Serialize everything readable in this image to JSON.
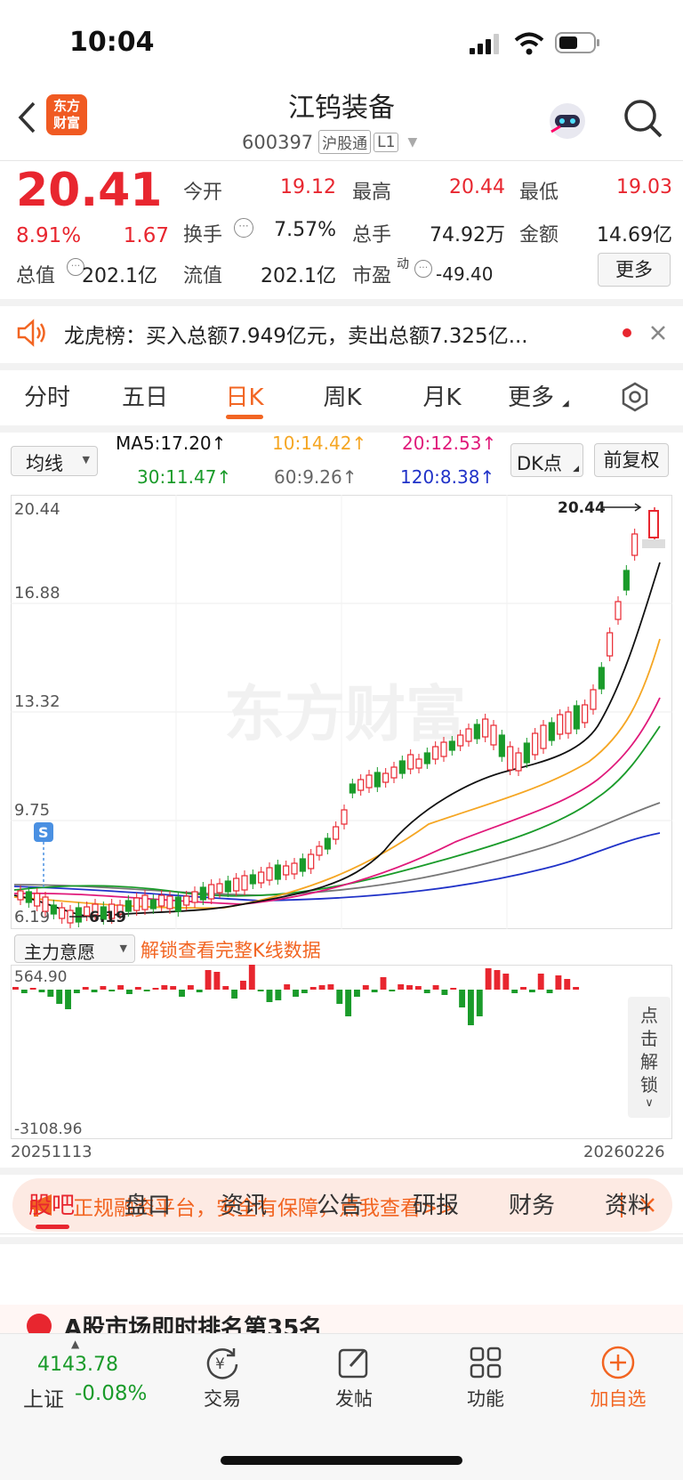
{
  "status": {
    "time": "10:04"
  },
  "header": {
    "logo_line1": "东方",
    "logo_line2": "财富",
    "name": "江钨装备",
    "code": "600397",
    "tag": "沪股通",
    "level": "L1"
  },
  "quote": {
    "price": "20.41",
    "pct": "8.91%",
    "chg": "1.67",
    "open_label": "今开",
    "open": "19.12",
    "high_label": "最高",
    "high": "20.44",
    "low_label": "最低",
    "low": "19.03",
    "turnover_label": "换手",
    "turnover": "7.57%",
    "volume_label": "总手",
    "volume": "74.92万",
    "amount_label": "金额",
    "amount": "14.69亿",
    "mcap_label": "总值",
    "mcap": "202.1亿",
    "float_label": "流值",
    "float": "202.1亿",
    "pe_label": "市盈",
    "pe_sup": "动",
    "pe": "-49.40",
    "more": "更多"
  },
  "notice": {
    "text": "龙虎榜：买入总额7.949亿元，卖出总额7.325亿..."
  },
  "tabs": [
    "分时",
    "五日",
    "日K",
    "周K",
    "月K",
    "更多"
  ],
  "ma": {
    "select": "均线",
    "ma5": "MA5:17.20",
    "ma10": "10:14.42",
    "ma20": "20:12.53",
    "ma30": "30:11.47",
    "ma60": "60:9.26",
    "ma120": "120:8.38",
    "dk": "DK点",
    "fq": "前复权",
    "arrow": "↑"
  },
  "kchart": {
    "y_labels": [
      "20.44",
      "16.88",
      "13.32",
      "9.75",
      "6.19"
    ],
    "max_label": "20.44",
    "min_label": "6.19",
    "s_marker": "S",
    "watermark": "东方财富"
  },
  "flow": {
    "select": "主力意愿",
    "unlock": "解锁查看完整K线数据",
    "top": "564.90",
    "bottom": "-3108.96",
    "side": "点击解锁",
    "date_start": "20251113",
    "date_end": "20260226"
  },
  "ad": {
    "text": "正规融资平台，安全有保障，点我查看>>"
  },
  "bottom_tabs": [
    "股吧",
    "盘口",
    "资讯",
    "公告",
    "研报",
    "财务",
    "资料"
  ],
  "feed_peek": "A股市场即时排名第35名",
  "nav": {
    "index_value": "4143.78",
    "index_name": "上证",
    "index_change": "-0.08%",
    "items": [
      "交易",
      "发帖",
      "功能",
      "加自选"
    ]
  },
  "colors": {
    "up": "#e8262f",
    "down": "#1a9b2a",
    "accent": "#f26522"
  }
}
